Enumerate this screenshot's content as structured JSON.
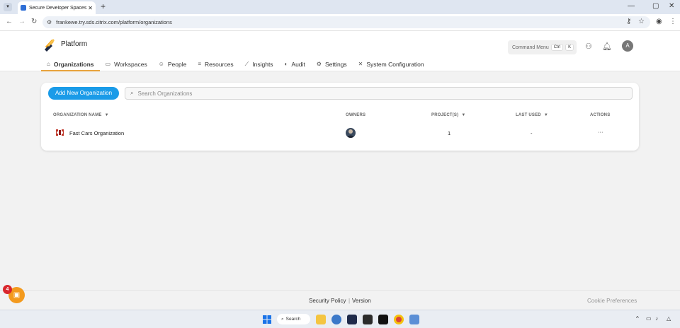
{
  "browser": {
    "tab_title": "Secure Developer Spaces Platf",
    "tab_close": "✕",
    "new_tab": "+",
    "url": "frankewe.try.sds.citrix.com/platform/organizations",
    "window_controls": [
      "—",
      "▢",
      "✕"
    ]
  },
  "app": {
    "name": "Platform",
    "command_menu": {
      "label": "Command Menu",
      "key1": "Ctrl",
      "key2": "K"
    },
    "user_initial": "A",
    "tabs": [
      {
        "label": "Organizations",
        "icon": "home-icon",
        "active": true
      },
      {
        "label": "Workspaces",
        "icon": "monitor-icon"
      },
      {
        "label": "People",
        "icon": "people-icon"
      },
      {
        "label": "Resources",
        "icon": "database-icon"
      },
      {
        "label": "Insights",
        "icon": "chart-icon"
      },
      {
        "label": "Audit",
        "icon": "shield-icon"
      },
      {
        "label": "Settings",
        "icon": "gear-icon"
      },
      {
        "label": "System Configuration",
        "icon": "tools-icon"
      }
    ]
  },
  "organizations": {
    "add_button": "Add New Organization",
    "search_placeholder": "Search Organizations",
    "columns": {
      "name": "ORGANIZATION NAME",
      "owners": "OWNERS",
      "projects": "PROJECT(S)",
      "last_used": "LAST USED",
      "actions": "ACTIONS"
    },
    "rows": [
      {
        "name": "Fast Cars Organization",
        "projects": "1",
        "last_used": "-",
        "actions": "···"
      }
    ]
  },
  "footer": {
    "security_policy": "Security Policy",
    "separator": "|",
    "version": "Version",
    "cookie": "Cookie Preferences",
    "notification_count": "4"
  },
  "taskbar": {
    "search_label": "Search"
  },
  "colors": {
    "accent": "#1a9be8",
    "tab_underline": "#e8a33d",
    "badge": "#d9262c"
  }
}
